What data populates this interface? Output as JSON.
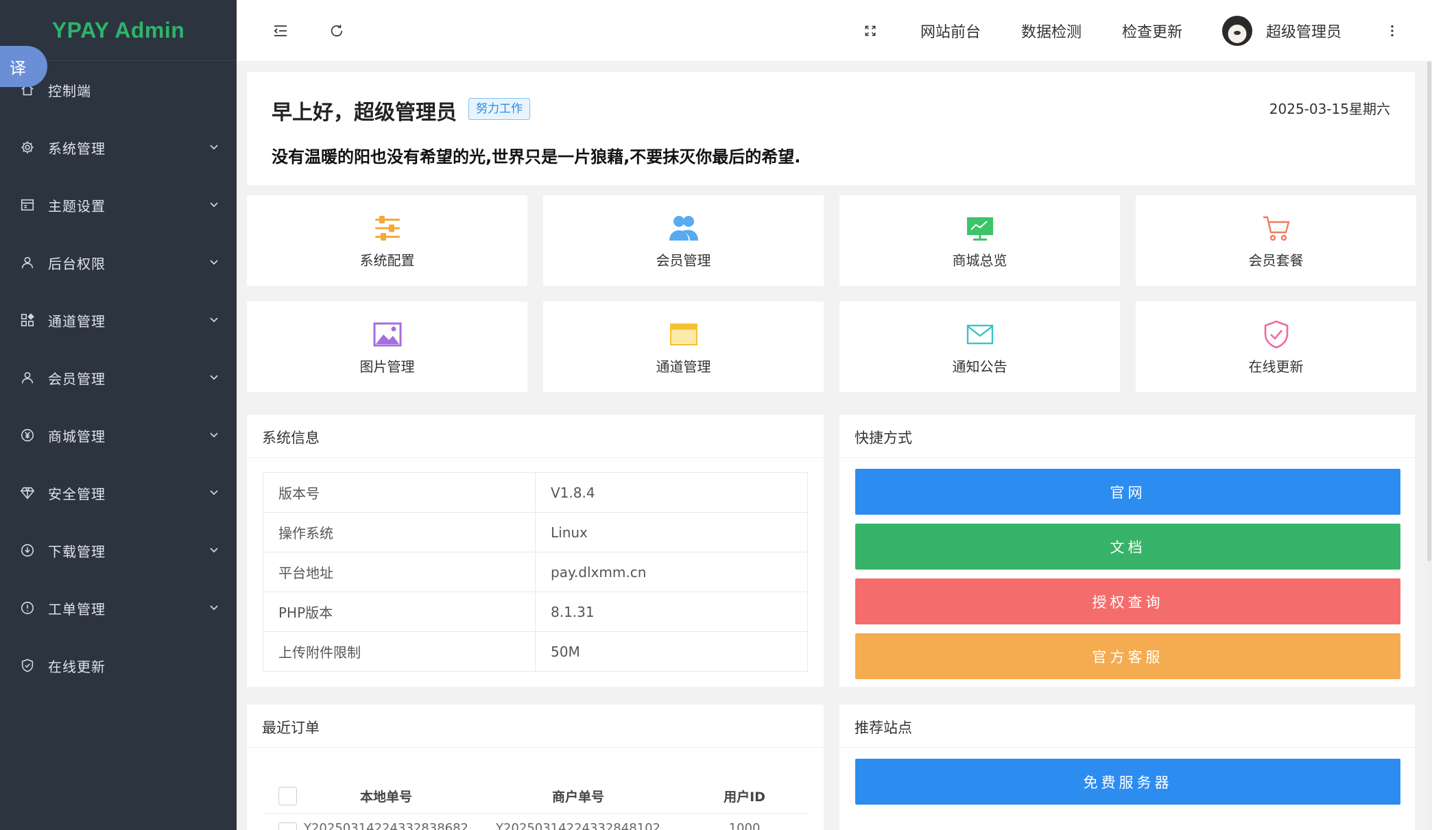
{
  "brand": "YPAY Admin",
  "translate_label": "译",
  "sidebar": {
    "items": [
      {
        "label": "控制端",
        "icon": "home-icon",
        "has_children": false
      },
      {
        "label": "系统管理",
        "icon": "gear-icon",
        "has_children": true
      },
      {
        "label": "主题设置",
        "icon": "theme-icon",
        "has_children": true
      },
      {
        "label": "后台权限",
        "icon": "user-icon",
        "has_children": true
      },
      {
        "label": "通道管理",
        "icon": "apps-icon",
        "has_children": true
      },
      {
        "label": "会员管理",
        "icon": "user-icon",
        "has_children": true
      },
      {
        "label": "商城管理",
        "icon": "yen-icon",
        "has_children": true
      },
      {
        "label": "安全管理",
        "icon": "diamond-icon",
        "has_children": true
      },
      {
        "label": "下载管理",
        "icon": "download-icon",
        "has_children": true
      },
      {
        "label": "工单管理",
        "icon": "info-icon",
        "has_children": true
      },
      {
        "label": "在线更新",
        "icon": "shield-check-icon",
        "has_children": false
      }
    ]
  },
  "topbar": {
    "links": [
      "网站前台",
      "数据检测",
      "检查更新"
    ],
    "user_name": "超级管理员"
  },
  "welcome": {
    "greeting": "早上好，超级管理员",
    "tag": "努力工作",
    "date": "2025-03-15星期六",
    "motto": "没有温暖的阳也没有希望的光,世界只是一片狼藉,不要抹灭你最后的希望."
  },
  "tiles": [
    {
      "label": "系统配置",
      "icon": "sliders-icon",
      "color": "#f5a83a"
    },
    {
      "label": "会员管理",
      "icon": "users-icon",
      "color": "#5aaaf0"
    },
    {
      "label": "商城总览",
      "icon": "presentation-icon",
      "color": "#3cc46a"
    },
    {
      "label": "会员套餐",
      "icon": "cart-icon",
      "color": "#f07a5a"
    },
    {
      "label": "图片管理",
      "icon": "image-icon",
      "color": "#a86be0"
    },
    {
      "label": "通道管理",
      "icon": "card-icon",
      "color": "#f5c332"
    },
    {
      "label": "通知公告",
      "icon": "mail-icon",
      "color": "#3cc4c4"
    },
    {
      "label": "在线更新",
      "icon": "shield-check-icon",
      "color": "#f06aa0"
    }
  ],
  "system_info": {
    "title": "系统信息",
    "rows": [
      {
        "key": "版本号",
        "value": "V1.8.4"
      },
      {
        "key": "操作系统",
        "value": "Linux"
      },
      {
        "key": "平台地址",
        "value": "pay.dlxmm.cn"
      },
      {
        "key": "PHP版本",
        "value": "8.1.31"
      },
      {
        "key": "上传附件限制",
        "value": "50M"
      }
    ]
  },
  "shortcuts": {
    "title": "快捷方式",
    "buttons": [
      {
        "label": "官网",
        "color": "#2d8cf0"
      },
      {
        "label": "文档",
        "color": "#36b368"
      },
      {
        "label": "授权查询",
        "color": "#f56c6c"
      },
      {
        "label": "官方客服",
        "color": "#f5ab50"
      }
    ]
  },
  "orders": {
    "title": "最近订单",
    "columns": [
      "本地单号",
      "商户单号",
      "用户ID"
    ],
    "first_row": [
      "Y20250314224332838682",
      "Y20250314224332848102",
      "1000"
    ]
  },
  "sites": {
    "title": "推荐站点",
    "button": "免费服务器",
    "button_color": "#2d8cf0"
  }
}
